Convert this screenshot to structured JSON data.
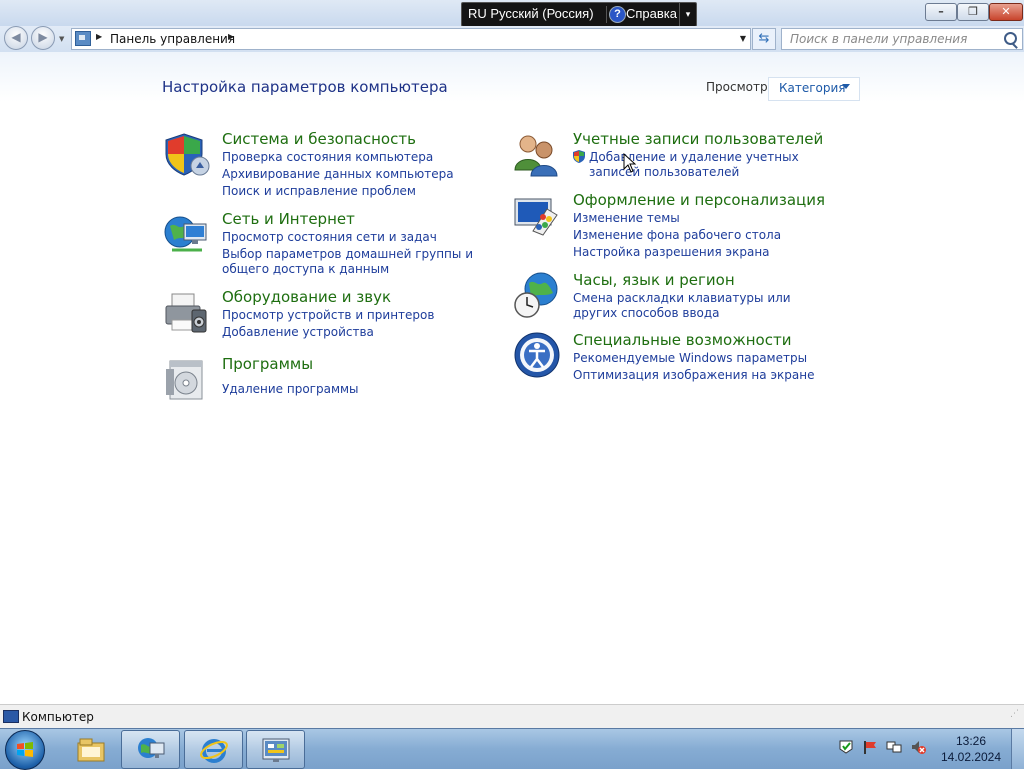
{
  "language_bar": {
    "language": "RU Русский (Россия)",
    "help": "Справка"
  },
  "window_controls": [
    "minimize",
    "maximize",
    "close"
  ],
  "address_bar": {
    "path": "Панель управления"
  },
  "search": {
    "placeholder": "Поиск в панели управления"
  },
  "main": {
    "heading": "Настройка параметров компьютера",
    "view_label": "Просмотр:",
    "view_value": "Категория",
    "categories": [
      {
        "title": "Система и безопасность",
        "icon": "shield-icon",
        "links": [
          "Проверка состояния компьютера",
          "Архивирование данных компьютера",
          "Поиск и исправление проблем"
        ]
      },
      {
        "title": "Сеть и Интернет",
        "icon": "network-globe-icon",
        "links": [
          "Просмотр состояния сети и задач",
          "Выбор параметров домашней группы и общего доступа к данным"
        ]
      },
      {
        "title": "Оборудование и звук",
        "icon": "printer-icon",
        "links": [
          "Просмотр устройств и принтеров",
          "Добавление устройства"
        ]
      },
      {
        "title": "Программы",
        "icon": "programs-icon",
        "links": [
          "Удаление программы"
        ]
      },
      {
        "title": "Учетные записи пользователей",
        "icon": "users-icon",
        "links": [
          "Добавление и удаление учетных записей пользователей"
        ]
      },
      {
        "title": "Оформление и персонализация",
        "icon": "personalization-icon",
        "links": [
          "Изменение темы",
          "Изменение фона рабочего стола",
          "Настройка разрешения экрана"
        ]
      },
      {
        "title": "Часы, язык и регион",
        "icon": "clock-globe-icon",
        "links": [
          "Смена раскладки клавиатуры или других способов ввода"
        ]
      },
      {
        "title": "Специальные возможности",
        "icon": "accessibility-icon",
        "links": [
          "Рекомендуемые Windows параметры",
          "Оптимизация изображения на экране"
        ]
      }
    ]
  },
  "status_bar": {
    "label": "Компьютер"
  },
  "taskbar": {
    "pinned": [
      "explorer-icon",
      "network-monitor-icon",
      "internet-explorer-icon",
      "control-panel-icon"
    ],
    "tray": [
      "action-center-icon",
      "security-flag-icon",
      "network-icon",
      "volume-muted-icon"
    ],
    "time": "13:26",
    "date": "14.02.2024"
  },
  "colors": {
    "link": "#1e3d9b",
    "category_title": "#1e6e10",
    "heading": "#1e3287"
  }
}
